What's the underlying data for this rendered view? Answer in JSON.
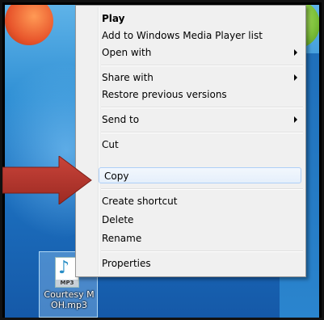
{
  "menu": {
    "items": [
      {
        "label": "Play",
        "bold": true,
        "submenu": false
      },
      {
        "label": "Add to Windows Media Player list",
        "submenu": false
      },
      {
        "label": "Open with",
        "submenu": true
      },
      {
        "label": "Share with",
        "submenu": true
      },
      {
        "label": "Restore previous versions",
        "submenu": false
      },
      {
        "label": "Send to",
        "submenu": true
      },
      {
        "label": "Cut",
        "submenu": false
      },
      {
        "label": "Copy",
        "submenu": false,
        "highlighted": true
      },
      {
        "label": "Create shortcut",
        "submenu": false
      },
      {
        "label": "Delete",
        "submenu": false
      },
      {
        "label": "Rename",
        "submenu": false
      },
      {
        "label": "Properties",
        "submenu": false
      }
    ]
  },
  "desktop_file": {
    "label": "Courtesy M OH.mp3",
    "type_tag": "MP3",
    "icon": "mp3-file-icon"
  },
  "pointer": {
    "icon": "red-arrow-icon",
    "color": "#b5322a"
  }
}
